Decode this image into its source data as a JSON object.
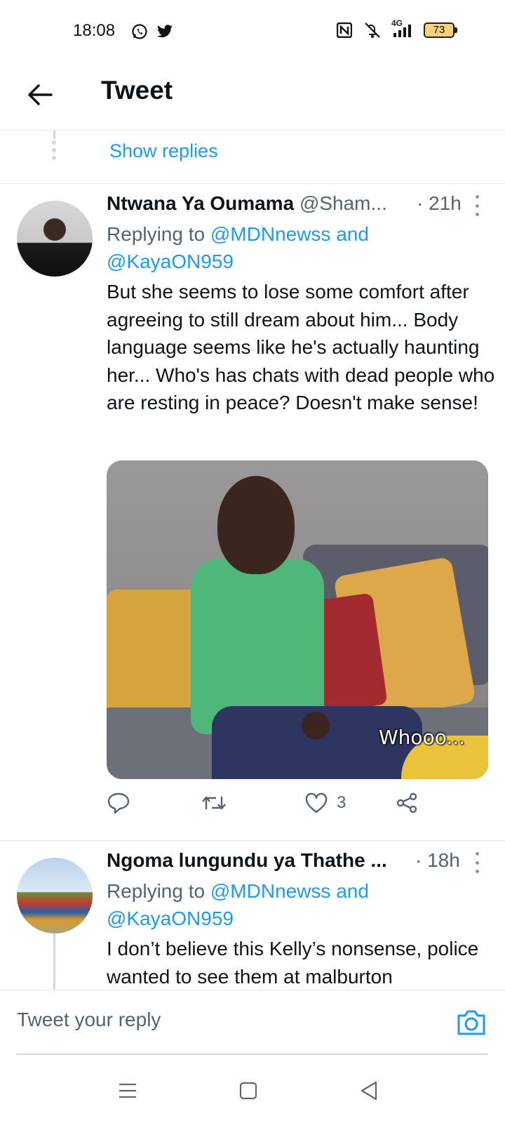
{
  "status_bar": {
    "time": "18:08",
    "left_icons": [
      "whatsapp-icon",
      "twitter-icon"
    ],
    "right_icons": [
      "nfc-icon",
      "mute-icon",
      "signal-icon"
    ],
    "network": "4G",
    "battery": "73"
  },
  "header": {
    "title": "Tweet"
  },
  "thread": {
    "show_replies_label": "Show replies"
  },
  "tweets": [
    {
      "display_name": "Ntwana Ya Oumama",
      "handle": "@Sham...",
      "time": "· 21h",
      "replying_prefix": "Replying to",
      "replying_mention_1": "@MDNnewss",
      "replying_and": "and",
      "replying_mention_2": "@KayaON959",
      "text": "But she seems to lose some comfort after agreeing to still dream about him... Body language seems like he's actually haunting her... Who's has chats with dead people who are resting in peace? Doesn't make sense!",
      "media_caption": "Whooo...",
      "likes": "3"
    },
    {
      "display_name": "Ngoma lungundu ya Thathe ...",
      "time": "· 18h",
      "replying_prefix": "Replying to",
      "replying_mention_1": "@MDNnewss",
      "replying_and": "and",
      "replying_mention_2": "@KayaON959",
      "text": "I don’t believe this Kelly’s nonsense, police wanted to see them at malburton"
    }
  ],
  "reply_bar": {
    "placeholder": "Tweet your reply"
  },
  "colors": {
    "accent": "#1d9bf0",
    "text": "#0f1419",
    "muted": "#536471",
    "divider": "#e6e9eb"
  }
}
